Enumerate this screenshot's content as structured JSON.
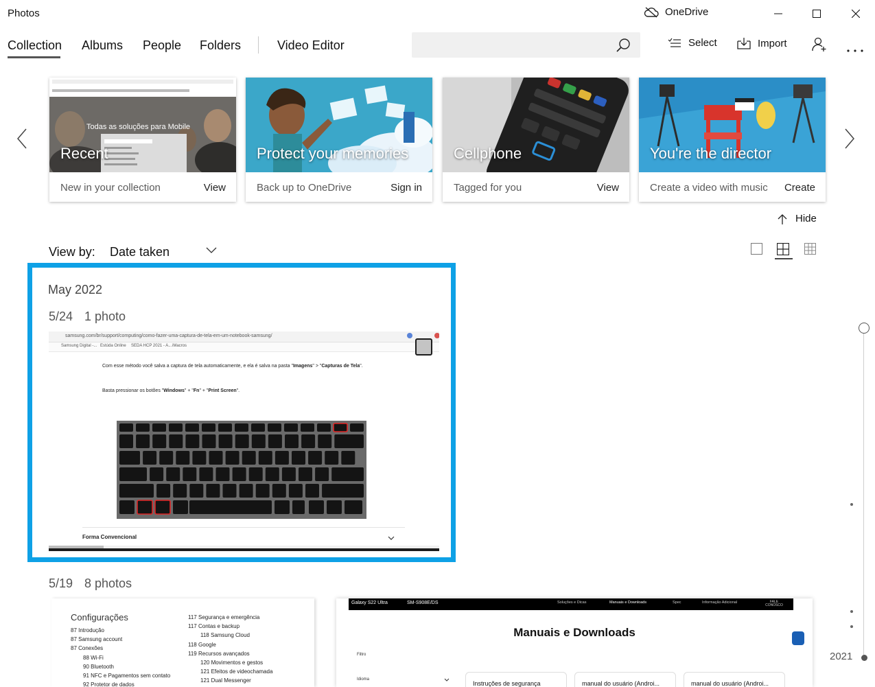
{
  "window": {
    "app_title": "Photos",
    "onedrive_label": "OneDrive"
  },
  "nav": {
    "tabs": [
      "Collection",
      "Albums",
      "People",
      "Folders",
      "Video Editor"
    ],
    "active_tab": "Collection"
  },
  "search": {
    "placeholder": ""
  },
  "toolbar": {
    "select_label": "Select",
    "import_label": "Import"
  },
  "cards": [
    {
      "title": "Recent",
      "subtitle": "New in your collection",
      "action": "View"
    },
    {
      "title": "Protect your memories",
      "subtitle": "Back up to OneDrive",
      "action": "Sign in"
    },
    {
      "title": "Cellphone",
      "subtitle": "Tagged for you",
      "action": "View"
    },
    {
      "title": "You're the director",
      "subtitle": "Create a video with music",
      "action": "Create"
    }
  ],
  "card_image_text": {
    "recent_overlay": "Todas as soluções para Mobile"
  },
  "hide_label": "Hide",
  "view_by": {
    "label": "View by:",
    "value": "Date taken"
  },
  "groups": [
    {
      "month": "May 2022",
      "days": [
        {
          "date": "5/24",
          "count": "1 photo"
        },
        {
          "date": "5/19",
          "count": "8 photos"
        }
      ]
    }
  ],
  "photo_1": {
    "url": "samsung.com/br/support/computing/como-fazer-uma-captura-de-tela-em-um-notebook-samsung/",
    "bookmarks": [
      "Samsung Digital -...",
      "Estúda Online",
      "SEDA HCP 2021 - A...",
      "iMacros"
    ],
    "line1_a": "Com esse método você salva a captura de tela automaticamente, e ela é salva na pasta \"",
    "line1_b": "Imagens",
    "line1_c": "\" > \"",
    "line1_d": "Capturas de Tela",
    "line1_e": "\".",
    "line2_a": "Basta pressionar os botões \"",
    "line2_b": "Windows",
    "line2_c": "\" + \"",
    "line2_d": "Fn",
    "line2_e": "\" + \"",
    "line2_f": "Print Screen",
    "line2_g": "\".",
    "section": "Forma Convencional"
  },
  "photo_2": {
    "heading": "Configurações",
    "left_items": [
      [
        "87",
        "Introdução"
      ],
      [
        "87",
        "Samsung account"
      ],
      [
        "87",
        "Conexões"
      ],
      [
        "88",
        "Wi-Fi"
      ],
      [
        "90",
        "Bluetooth"
      ],
      [
        "91",
        "NFC e Pagamentos sem contato"
      ],
      [
        "92",
        "Protetor de dados"
      ]
    ],
    "right_items": [
      [
        "117",
        "Segurança e emergência"
      ],
      [
        "117",
        "Contas e backup"
      ],
      [
        "118",
        "Samsung Cloud"
      ],
      [
        "118",
        "Google"
      ],
      [
        "119",
        "Recursos avançados"
      ],
      [
        "120",
        "Movimentos e gestos"
      ],
      [
        "121",
        "Efeitos de videochamada"
      ],
      [
        "121",
        "Dual Messenger"
      ]
    ]
  },
  "photo_3": {
    "model": "Galaxy S22 Ultra",
    "model_code": "SM-S908E/DS",
    "nav_items": [
      "Soluções e Dicas",
      "Manuais e Downloads",
      "Spec",
      "Informação Adicional",
      "FALE CONOSCO"
    ],
    "title": "Manuais e Downloads",
    "filter": "Filtro",
    "idioma": "Idioma",
    "docs": [
      "Instruções de segurança",
      "manual do usuário (Androi...",
      "manual do usuário (Androi..."
    ]
  },
  "timeline": {
    "year": "2021"
  },
  "colors": {
    "focus_border": "#0ea1e6"
  },
  "icons": [
    "cloud-off-icon",
    "minimize-icon",
    "maximize-icon",
    "close-icon",
    "search-icon",
    "select-list-icon",
    "import-icon",
    "add-person-icon",
    "more-icon",
    "chevron-left-icon",
    "chevron-right-icon",
    "arrow-up-icon",
    "chevron-down-icon",
    "single-view-icon",
    "medium-grid-icon",
    "small-grid-icon",
    "checkbox-icon"
  ]
}
